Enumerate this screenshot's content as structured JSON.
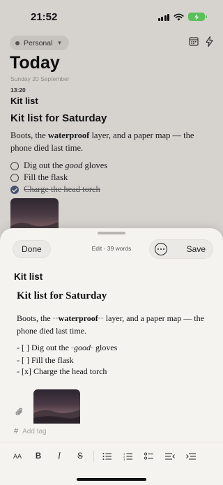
{
  "status_bar": {
    "time": "21:52"
  },
  "background": {
    "journal_chip": "Personal",
    "title": "Today",
    "date": "Sunday 20 September",
    "time": "13:20",
    "entry_title": "Kit list",
    "heading": "Kit list for Saturday",
    "paragraph": {
      "before": "Boots, the ",
      "bold": "waterproof",
      "after": " layer, and a paper map — the phone died last time."
    },
    "checklist": [
      {
        "before": "Dig out the ",
        "italic": "good",
        "after": " gloves",
        "done": false
      },
      {
        "before": "Fill the flask",
        "italic": "",
        "after": "",
        "done": false
      },
      {
        "before": "Charge the head torch",
        "italic": "",
        "after": "",
        "done": true
      }
    ]
  },
  "sheet": {
    "done_label": "Done",
    "meta": "Edit · 39 words",
    "save_label": "Save",
    "entry_title": "Kit list",
    "heading": "Kit list for Saturday",
    "paragraph": {
      "before": "Boots, the ",
      "md_open": "**",
      "bold": "waterproof",
      "md_close": "**",
      "after": " layer, and a paper map — the phone died last time."
    },
    "list": [
      {
        "before": "- [ ] Dig out the ",
        "md_open": "*",
        "italic": "good",
        "md_close": "*",
        "after": " gloves"
      },
      {
        "before": "- [ ] Fill the flask",
        "md_open": "",
        "italic": "",
        "md_close": "",
        "after": ""
      },
      {
        "before": "- [x] Charge the head torch",
        "md_open": "",
        "italic": "",
        "md_close": "",
        "after": ""
      }
    ],
    "tag_prefix": "#",
    "tag_placeholder": "Add tag",
    "format_bar": {
      "text_size": "AA",
      "bold": "B",
      "italic": "I",
      "strike": "S"
    }
  }
}
